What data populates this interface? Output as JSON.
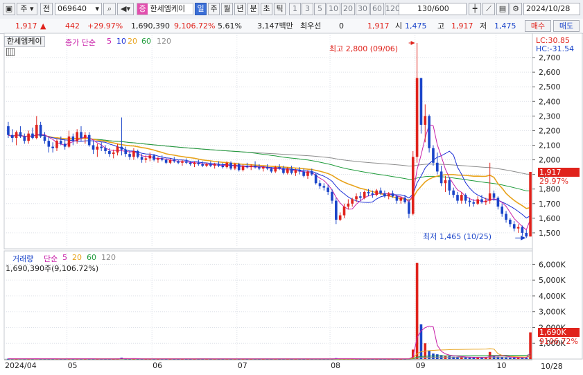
{
  "toolbar": {
    "type_label": "주",
    "nav_label": "전",
    "code": "069640",
    "stock_tag": "증",
    "stock_name": "한세엠케이",
    "periods": [
      "일",
      "주",
      "월",
      "년",
      "분",
      "초",
      "틱"
    ],
    "active_period": "일",
    "intervals": [
      "1",
      "3",
      "5",
      "10",
      "20",
      "30",
      "60",
      "120"
    ],
    "count": "130/600",
    "date": "2024/10/28"
  },
  "quote": {
    "price": "1,917",
    "change": "442",
    "change_pct": "+29.97%",
    "volume": "1,690,390",
    "volume_pct": "9,106.72%",
    "turnover": "5.61%",
    "amount": "3,147백만",
    "pref_label": "최우선",
    "pref_value": "0",
    "pref_price": "1,917",
    "open_label": "시",
    "open": "1,475",
    "high_label": "고",
    "high": "1,917",
    "low_label": "저",
    "low": "1,475",
    "buy_label": "매수",
    "sell_label": "매도"
  },
  "price_panel": {
    "tab_label": "한세엠케이",
    "legend_label": "종가 단순",
    "ma_periods": [
      "5",
      "10",
      "20",
      "60",
      "120"
    ],
    "ma_colors": [
      "#c81fa8",
      "#1b2fd6",
      "#e8a31b",
      "#1e9b3a",
      "#8c8c8c"
    ],
    "lc_label": "LC:30.85",
    "hc_label": "HC:-31.54",
    "high_note": "최고 2,800 (09/06)",
    "low_note": "최저 1,465 (10/25)",
    "last_price_tag": "1,917",
    "last_pct_tag": "29.97%"
  },
  "volume_panel": {
    "legend_label": "거래량",
    "legend_ma_label": "단순",
    "ma_periods": [
      "5",
      "20",
      "60",
      "120"
    ],
    "ma_colors": [
      "#c81fa8",
      "#e8a31b",
      "#1e9b3a",
      "#8c8c8c"
    ],
    "current_text": "1,690,390주(9,106.72%)",
    "last_vol_tag": "1,690K",
    "last_pct_tag": "9106.72%"
  },
  "x_axis": {
    "labels": [
      "2024/04",
      "05",
      "06",
      "07",
      "08",
      "09",
      "10"
    ],
    "right_label": "10/28"
  },
  "colors": {
    "up": "#e0231c",
    "down": "#1b45c9",
    "grid": "#dde1e8",
    "accent": "#3c6fd6"
  },
  "chart_data": [
    {
      "type": "candlestick",
      "title": "한세엠케이",
      "x_labels": [
        "2024/04",
        "05",
        "06",
        "07",
        "08",
        "09",
        "10"
      ],
      "ylim": [
        1400,
        2800
      ],
      "y_ticks": [
        1500,
        1600,
        1700,
        1800,
        1900,
        2000,
        2100,
        2200,
        2300,
        2400,
        2500,
        2600,
        2700
      ],
      "moving_averages": [
        "5",
        "10",
        "20",
        "60",
        "120"
      ],
      "annotations": [
        {
          "label": "최고 2,800 (09/06)",
          "value": 2800
        },
        {
          "label": "최저 1,465 (10/25)",
          "value": 1465
        }
      ],
      "last_close": 1917,
      "ohlc": [
        [
          2230,
          2260,
          2150,
          2170
        ],
        [
          2170,
          2210,
          2120,
          2150
        ],
        [
          2150,
          2200,
          2100,
          2190
        ],
        [
          2190,
          2230,
          2150,
          2160
        ],
        [
          2160,
          2180,
          2110,
          2130
        ],
        [
          2130,
          2200,
          2110,
          2180
        ],
        [
          2180,
          2220,
          2140,
          2150
        ],
        [
          2150,
          2300,
          2140,
          2240
        ],
        [
          2240,
          2260,
          2150,
          2160
        ],
        [
          2160,
          2190,
          2110,
          2130
        ],
        [
          2130,
          2160,
          2050,
          2090
        ],
        [
          2090,
          2120,
          2050,
          2080
        ],
        [
          2080,
          2140,
          2060,
          2130
        ],
        [
          2130,
          2160,
          2100,
          2110
        ],
        [
          2110,
          2140,
          2070,
          2090
        ],
        [
          2090,
          2200,
          2080,
          2160
        ],
        [
          2160,
          2180,
          2100,
          2130
        ],
        [
          2130,
          2210,
          2110,
          2190
        ],
        [
          2190,
          2230,
          2130,
          2150
        ],
        [
          2150,
          2190,
          2110,
          2170
        ],
        [
          2170,
          2190,
          2090,
          2100
        ],
        [
          2100,
          2130,
          2040,
          2070
        ],
        [
          2070,
          2110,
          2020,
          2090
        ],
        [
          2090,
          2120,
          2060,
          2080
        ],
        [
          2080,
          2100,
          2040,
          2060
        ],
        [
          2060,
          2080,
          2020,
          2040
        ],
        [
          2040,
          2070,
          2010,
          2050
        ],
        [
          2050,
          2110,
          2030,
          2090
        ],
        [
          2090,
          2290,
          2030,
          2070
        ],
        [
          2070,
          2090,
          2020,
          2040
        ],
        [
          2040,
          2060,
          2000,
          2020
        ],
        [
          2020,
          2080,
          2000,
          2060
        ],
        [
          2060,
          2070,
          2010,
          2020
        ],
        [
          2020,
          2040,
          1980,
          2000
        ],
        [
          2000,
          2030,
          1980,
          2010
        ],
        [
          2010,
          2050,
          1990,
          2030
        ],
        [
          2030,
          2040,
          1990,
          2000
        ],
        [
          2000,
          2020,
          1980,
          2010
        ],
        [
          2010,
          2030,
          1990,
          2000
        ],
        [
          2000,
          2010,
          1970,
          1980
        ],
        [
          1980,
          2010,
          1970,
          2000
        ],
        [
          2000,
          2020,
          1980,
          1990
        ],
        [
          1990,
          2000,
          1970,
          1980
        ],
        [
          1980,
          2000,
          1960,
          1990
        ],
        [
          1990,
          2010,
          1970,
          1980
        ],
        [
          1980,
          1990,
          1960,
          1970
        ],
        [
          1970,
          1990,
          1950,
          1980
        ],
        [
          1980,
          2000,
          1960,
          1970
        ],
        [
          1970,
          1990,
          1950,
          1960
        ],
        [
          1960,
          1980,
          1950,
          1970
        ],
        [
          1970,
          1990,
          1950,
          1960
        ],
        [
          1960,
          1980,
          1940,
          1970
        ],
        [
          1970,
          1990,
          1950,
          1960
        ],
        [
          1960,
          1980,
          1940,
          1950
        ],
        [
          1950,
          1990,
          1940,
          1980
        ],
        [
          1980,
          1990,
          1930,
          1940
        ],
        [
          1940,
          1980,
          1930,
          1970
        ],
        [
          1970,
          1980,
          1920,
          1930
        ],
        [
          1930,
          1970,
          1920,
          1960
        ],
        [
          1960,
          1980,
          1940,
          1950
        ],
        [
          1950,
          1970,
          1930,
          1960
        ],
        [
          1960,
          1990,
          1940,
          1950
        ],
        [
          1950,
          1970,
          1930,
          1940
        ],
        [
          1940,
          1960,
          1920,
          1950
        ],
        [
          1950,
          1970,
          1930,
          1940
        ],
        [
          1940,
          1950,
          1910,
          1920
        ],
        [
          1920,
          1960,
          1910,
          1950
        ],
        [
          1950,
          1970,
          1930,
          1940
        ],
        [
          1940,
          1960,
          1900,
          1910
        ],
        [
          1910,
          1950,
          1900,
          1940
        ],
        [
          1940,
          1960,
          1900,
          1910
        ],
        [
          1910,
          1940,
          1890,
          1930
        ],
        [
          1930,
          1950,
          1900,
          1920
        ],
        [
          1920,
          1940,
          1880,
          1890
        ],
        [
          1890,
          1930,
          1870,
          1920
        ],
        [
          1920,
          1940,
          1890,
          1900
        ],
        [
          1900,
          1910,
          1830,
          1840
        ],
        [
          1840,
          1860,
          1800,
          1820
        ],
        [
          1820,
          1840,
          1790,
          1810
        ],
        [
          1810,
          1830,
          1760,
          1780
        ],
        [
          1780,
          1800,
          1700,
          1720
        ],
        [
          1720,
          1740,
          1560,
          1590
        ],
        [
          1590,
          1640,
          1580,
          1620
        ],
        [
          1620,
          1700,
          1600,
          1680
        ],
        [
          1680,
          1730,
          1660,
          1700
        ],
        [
          1700,
          1740,
          1680,
          1730
        ],
        [
          1730,
          1770,
          1710,
          1750
        ],
        [
          1750,
          1780,
          1720,
          1740
        ],
        [
          1740,
          1790,
          1730,
          1780
        ],
        [
          1780,
          1800,
          1750,
          1770
        ],
        [
          1770,
          1790,
          1740,
          1760
        ],
        [
          1760,
          1800,
          1750,
          1790
        ],
        [
          1790,
          1810,
          1760,
          1770
        ],
        [
          1770,
          1790,
          1740,
          1750
        ],
        [
          1750,
          1780,
          1730,
          1770
        ],
        [
          1770,
          1790,
          1740,
          1750
        ],
        [
          1750,
          1760,
          1700,
          1720
        ],
        [
          1720,
          1750,
          1700,
          1740
        ],
        [
          1740,
          1760,
          1700,
          1710
        ],
        [
          1710,
          1730,
          1600,
          1630
        ],
        [
          1630,
          2060,
          1620,
          2020
        ],
        [
          2020,
          2800,
          1980,
          2560
        ],
        [
          2560,
          2520,
          2180,
          2240
        ],
        [
          2240,
          2380,
          2120,
          2300
        ],
        [
          2300,
          2310,
          2050,
          2080
        ],
        [
          2080,
          2100,
          1960,
          1980
        ],
        [
          1980,
          2050,
          1900,
          1920
        ],
        [
          1920,
          1960,
          1820,
          1840
        ],
        [
          1840,
          1890,
          1780,
          1860
        ],
        [
          1860,
          1880,
          1760,
          1790
        ],
        [
          1790,
          1810,
          1740,
          1760
        ],
        [
          1760,
          1780,
          1700,
          1720
        ],
        [
          1720,
          1780,
          1700,
          1760
        ],
        [
          1760,
          1770,
          1700,
          1720
        ],
        [
          1720,
          1740,
          1680,
          1710
        ],
        [
          1710,
          1730,
          1680,
          1700
        ],
        [
          1700,
          1750,
          1690,
          1730
        ],
        [
          1730,
          1760,
          1700,
          1710
        ],
        [
          1710,
          1740,
          1690,
          1720
        ],
        [
          1720,
          1980,
          1700,
          1770
        ],
        [
          1770,
          1790,
          1720,
          1740
        ],
        [
          1740,
          1750,
          1660,
          1680
        ],
        [
          1680,
          1700,
          1610,
          1630
        ],
        [
          1630,
          1650,
          1570,
          1590
        ],
        [
          1590,
          1600,
          1540,
          1560
        ],
        [
          1560,
          1580,
          1510,
          1530
        ],
        [
          1530,
          1560,
          1500,
          1540
        ],
        [
          1540,
          1550,
          1480,
          1500
        ],
        [
          1500,
          1520,
          1465,
          1475
        ],
        [
          1475,
          1917,
          1475,
          1917
        ]
      ]
    },
    {
      "type": "bar",
      "title": "거래량",
      "ylim": [
        0,
        6500000
      ],
      "y_ticks": [
        1000000,
        2000000,
        3000000,
        4000000,
        5000000,
        6000000
      ],
      "y_tick_labels": [
        "1,000K",
        "2,000K",
        "3,000K",
        "4,000K",
        "5,000K",
        "6,000K"
      ],
      "moving_averages": [
        "5",
        "20",
        "60",
        "120"
      ],
      "values": [
        20000,
        18000,
        15000,
        22000,
        16000,
        19000,
        17000,
        28000,
        15000,
        14000,
        16000,
        15000,
        17000,
        14000,
        13000,
        18000,
        15000,
        19000,
        16000,
        14000,
        15000,
        14000,
        13000,
        15000,
        12000,
        13000,
        12000,
        14000,
        90000,
        14000,
        12000,
        13000,
        11000,
        12000,
        11000,
        13000,
        12000,
        11000,
        12000,
        10000,
        11000,
        10000,
        11000,
        10000,
        11000,
        10000,
        11000,
        10000,
        10000,
        11000,
        10000,
        11000,
        10000,
        10000,
        12000,
        10000,
        11000,
        10000,
        11000,
        10000,
        10000,
        11000,
        10000,
        10000,
        11000,
        10000,
        11000,
        10000,
        12000,
        11000,
        10000,
        11000,
        12000,
        10000,
        11000,
        12000,
        15000,
        13000,
        12000,
        14000,
        16000,
        60000,
        20000,
        15000,
        18000,
        14000,
        16000,
        15000,
        13000,
        14000,
        12000,
        13000,
        12000,
        11000,
        12000,
        11000,
        12000,
        11000,
        13000,
        40000,
        600000,
        6100000,
        2200000,
        1000000,
        550000,
        350000,
        300000,
        250000,
        200000,
        180000,
        150000,
        130000,
        120000,
        110000,
        100000,
        90000,
        95000,
        85000,
        90000,
        450000,
        200000,
        150000,
        120000,
        100000,
        90000,
        85000,
        80000,
        75000,
        90000,
        1690390
      ]
    }
  ]
}
